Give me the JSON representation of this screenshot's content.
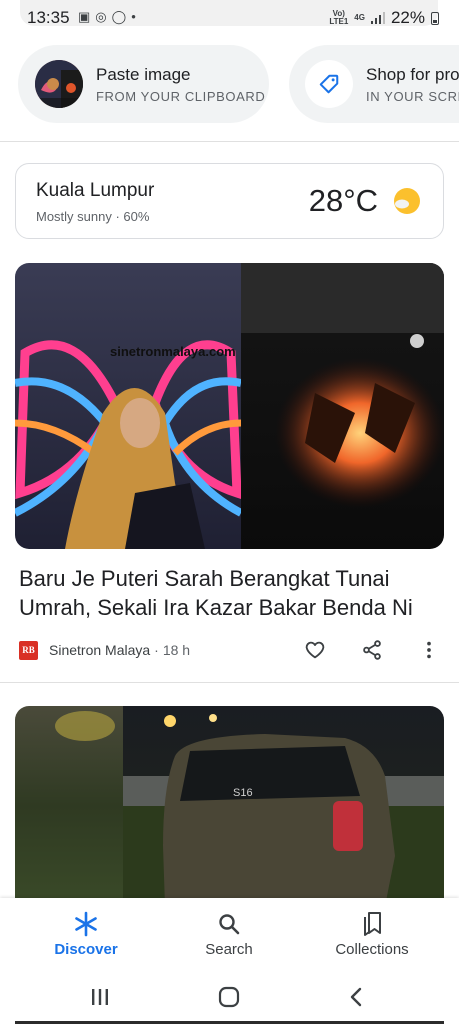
{
  "status_bar": {
    "time": "13:35",
    "network_top": "Vo)",
    "network_sub": "LTE1",
    "network_type": "4G",
    "battery": "22%"
  },
  "lens_chips": [
    {
      "title": "Paste image",
      "subtitle": "FROM YOUR CLIPBOARD"
    },
    {
      "title": "Shop for pro",
      "subtitle": "IN YOUR SCRE"
    }
  ],
  "weather": {
    "city": "Kuala Lumpur",
    "description": "Mostly sunny · 60%",
    "temperature": "28°C",
    "icon": "sun-icon"
  },
  "article": {
    "image_watermark": "sinetronmalaya.com",
    "title": "Baru Je Puteri Sarah Berangkat Tunai Umrah, Sekali Ira Kazar Bakar Benda Ni",
    "source_logo": "RB",
    "source": "Sinetron Malaya",
    "separator": "·",
    "age": "18 h"
  },
  "article2": {
    "plate_text": "S16"
  },
  "bottom_nav": {
    "items": [
      {
        "label": "Discover",
        "icon": "asterisk-icon",
        "active": true
      },
      {
        "label": "Search",
        "icon": "search-icon",
        "active": false
      },
      {
        "label": "Collections",
        "icon": "collections-icon",
        "active": false
      }
    ]
  },
  "colors": {
    "accent": "#1a73e8",
    "chip_bg": "#f1f3f4",
    "text_primary": "#202124",
    "text_secondary": "#5f6368",
    "sun": "#fbc02d"
  }
}
